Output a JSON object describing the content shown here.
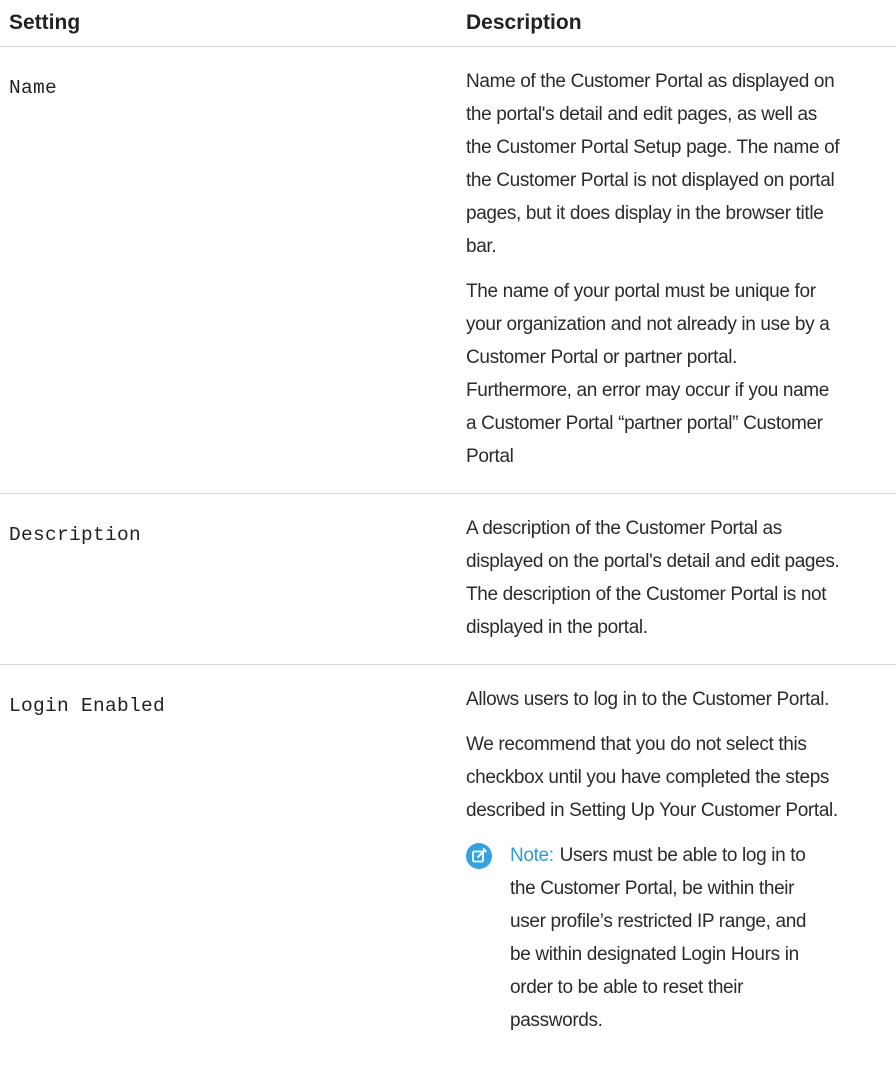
{
  "table": {
    "headers": {
      "setting": "Setting",
      "description": "Description"
    },
    "rows": [
      {
        "setting": "Name",
        "paragraphs": [
          [
            "Name of the Customer Portal as displayed on",
            "the portal's detail and edit pages, as well as",
            "the Customer Portal Setup page. The name of",
            "the Customer Portal is not displayed on portal",
            "pages, but it does display in the browser title",
            "bar."
          ],
          [
            "The name of your portal must be unique for",
            "your organization and not already in use by a",
            "Customer Portal or partner portal.",
            "Furthermore, an error may occur if you name",
            "a Customer Portal “partner portal” Customer",
            "Portal"
          ]
        ]
      },
      {
        "setting": "Description",
        "paragraphs": [
          [
            "A description of the Customer Portal as",
            "displayed on the portal's detail and edit pages.",
            "The description of the Customer Portal is not",
            "displayed in the portal."
          ]
        ]
      },
      {
        "setting": "Login Enabled",
        "paragraphs": [
          [
            "Allows users to log in to the Customer Portal."
          ],
          [
            "We recommend that you do not select this",
            "checkbox until you have completed the steps",
            "described in Setting Up Your Customer Portal."
          ]
        ],
        "note": {
          "icon": "edit-note-icon",
          "label": "Note:",
          "lines": [
            "Users must be able to log in to",
            "the Customer Portal, be within their",
            "user profile’s restricted IP range, and",
            "be within designated Login Hours in",
            "order to be able to reset their",
            "passwords."
          ]
        }
      }
    ]
  },
  "colors": {
    "note_accent": "#2c9bd8",
    "divider": "#d6d6d6",
    "text": "#222222"
  }
}
